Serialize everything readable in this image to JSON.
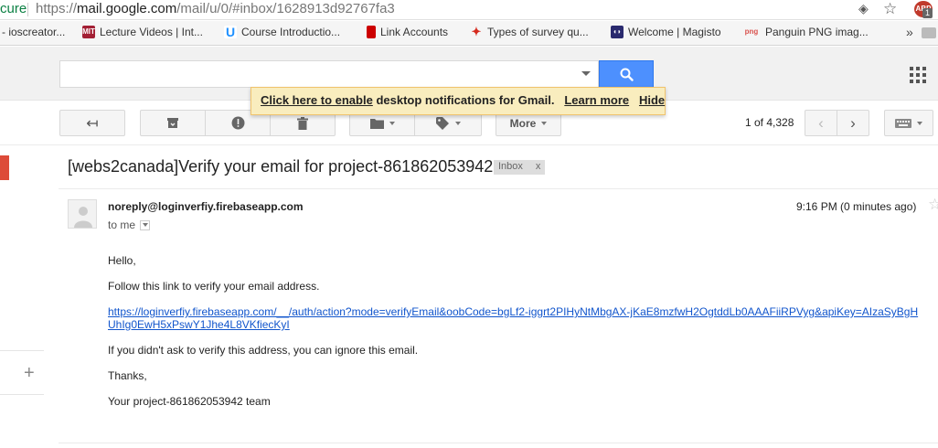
{
  "browser": {
    "secure_label": "cure",
    "url_prefix": "https://",
    "url_host": "mail.google.com",
    "url_path": "/mail/u/0/#inbox/1628913d92767fa3",
    "extension_badge": "1",
    "extension_label": "ABP"
  },
  "bookmarks": [
    {
      "label": "- ioscreator...",
      "icon": "page-icon",
      "color": "#999999"
    },
    {
      "label": "Lecture Videos | Int...",
      "icon": "mit-icon",
      "color": "#a31f34"
    },
    {
      "label": "Course Introductio...",
      "icon": "udemy-icon",
      "color": "#1e90ff"
    },
    {
      "label": "Link Accounts",
      "icon": "bookmark-icon",
      "color": "#cc0000"
    },
    {
      "label": "Types of survey qu...",
      "icon": "maple-leaf-icon",
      "color": "#d52b1e"
    },
    {
      "label": "Welcome | Magisto",
      "icon": "magisto-icon",
      "color": "#2a2a6e"
    },
    {
      "label": "Panguin PNG imag...",
      "icon": "png-icon",
      "color": "#d9534f"
    }
  ],
  "bookmarks_more": "»",
  "gmail": {
    "search_value": "",
    "notification": {
      "enable_link": "Click here to enable",
      "text": " desktop notifications for Gmail.",
      "learn_more": "Learn more",
      "hide": "Hide"
    },
    "toolbar": {
      "more_label": "More",
      "pager": "1 of 4,328"
    },
    "subject": "[webs2canada]Verify your email for project-861862053942",
    "label_chip": {
      "name": "Inbox",
      "remove": "x"
    },
    "message": {
      "sender": "noreply@loginverfiy.firebaseapp.com",
      "to": "to me",
      "time": "9:16 PM (0 minutes ago)",
      "greeting": "Hello,",
      "instruction": "Follow this link to verify your email address.",
      "link": "https://loginverfiy.firebaseapp.com/__/auth/action?mode=verifyEmail&oobCode=bgLf2-iggrt2PIHyNtMbgAX-jKaE8mzfwH2OgtddLb0AAAFiiRPVyg&apiKey=AIzaSyBgHUhIg0EwH5xPswY1Jhe4L8VKfiecKyI",
      "ignore": "If you didn't ask to verify this address, you can ignore this email.",
      "thanks": "Thanks,",
      "signature": "Your project-861862053942 team"
    }
  },
  "colors": {
    "search_blue": "#4d90fe",
    "notify_bg": "#f9edbe",
    "compose_red": "#dd4b39",
    "link_blue": "#1155cc"
  }
}
